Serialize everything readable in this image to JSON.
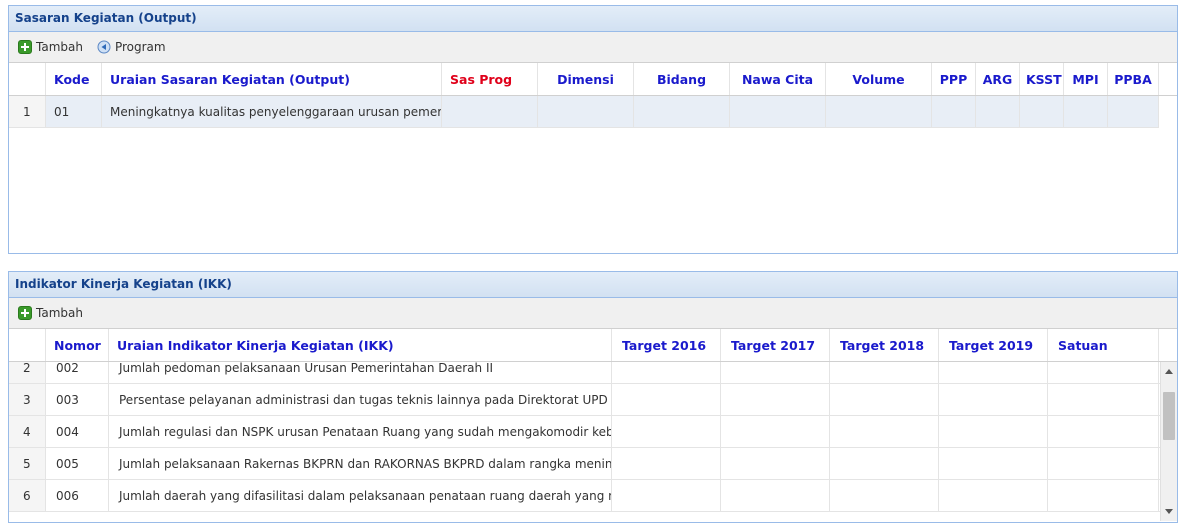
{
  "top_panel": {
    "title": "Sasaran Kegiatan (Output)",
    "toolbar": {
      "add_label": "Tambah",
      "program_label": "Program"
    },
    "columns": [
      "",
      "Kode",
      "Uraian Sasaran Kegiatan (Output)",
      "Sas Prog",
      "Dimensi",
      "Bidang",
      "Nawa Cita",
      "Volume",
      "PPP",
      "ARG",
      "KSST",
      "MPI",
      "PPBA"
    ],
    "rows": [
      {
        "num": "1",
        "kode": "01",
        "uraian": "Meningkatnya kualitas penyelenggaraan urusan pemerintahan"
      }
    ]
  },
  "bottom_panel": {
    "title": "Indikator Kinerja Kegiatan (IKK)",
    "toolbar": {
      "add_label": "Tambah"
    },
    "columns": [
      "",
      "Nomor",
      "Uraian Indikator Kinerja Kegiatan (IKK)",
      "Target 2016",
      "Target 2017",
      "Target 2018",
      "Target 2019",
      "Satuan"
    ],
    "rows": [
      {
        "num": "2",
        "nomor": "002",
        "uraian": "Jumlah pedoman pelaksanaan Urusan Pemerintahan Daerah II"
      },
      {
        "num": "3",
        "nomor": "003",
        "uraian": "Persentase pelayanan administrasi dan tugas teknis lainnya pada Direktorat UPD II"
      },
      {
        "num": "4",
        "nomor": "004",
        "uraian": "Jumlah regulasi dan NSPK urusan Penataan Ruang yang sudah mengakomodir kebijakan"
      },
      {
        "num": "5",
        "nomor": "005",
        "uraian": "Jumlah pelaksanaan Rakernas BKPRN dan RAKORNAS BKPRD dalam rangka meningkatkan"
      },
      {
        "num": "6",
        "nomor": "006",
        "uraian": "Jumlah daerah yang difasilitasi dalam pelaksanaan penataan ruang daerah yang memadai"
      }
    ]
  }
}
